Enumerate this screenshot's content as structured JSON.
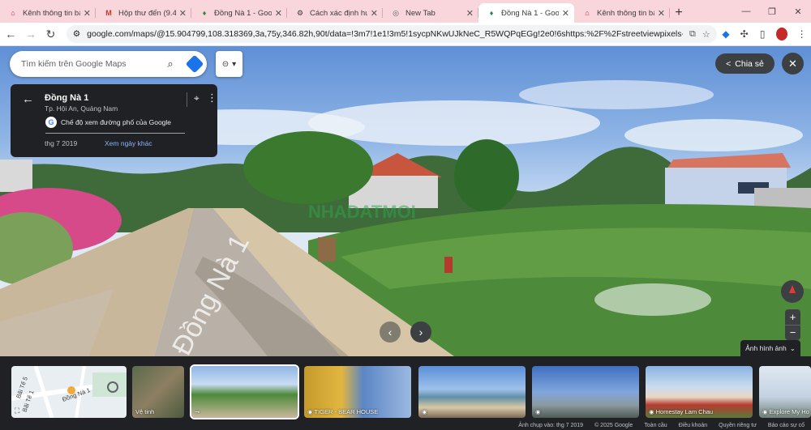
{
  "browser": {
    "tabs": [
      {
        "title": "Kênh thông tin bất đ",
        "icon": "home-icon",
        "icon_color": "#c62828",
        "active": false
      },
      {
        "title": "Hộp thư đến (9.470)",
        "icon": "gmail-icon",
        "icon_color": "#d93025",
        "active": false
      },
      {
        "title": "Đồng Nà 1 - Google",
        "icon": "maps-pin-icon",
        "icon_color": "#1e8e3e",
        "active": false
      },
      {
        "title": "Cách xác định hướng",
        "icon": "gear-icon",
        "icon_color": "#333333",
        "active": false
      },
      {
        "title": "New Tab",
        "icon": "chrome-icon",
        "icon_color": "#5f6368",
        "active": false
      },
      {
        "title": "Đồng Nà 1 - Google",
        "icon": "maps-pin-icon",
        "icon_color": "#1e8e3e",
        "active": true
      },
      {
        "title": "Kênh thông tin bất đ",
        "icon": "home-icon",
        "icon_color": "#c62828",
        "active": false
      }
    ],
    "url": "google.com/maps/@15.904799,108.318369,3a,75y,346.82h,90t/data=!3m7!1e1!3m5!1sycpNKwUJkNeC_R5WQPqEGg!2e0!6shttps:%2F%2Fstreetviewpixels-pa.googleapis.com%2Fv1..."
  },
  "search": {
    "placeholder": "Tìm kiếm trên Google Maps"
  },
  "info_card": {
    "title": "Đồng Nà 1",
    "subtitle": "Tp. Hội An, Quảng Nam",
    "mode_label": "Chế độ xem đường phố của Google",
    "capture_date": "thg 7 2019",
    "more_dates_label": "Xem ngày khác"
  },
  "share_label": "Chia sẻ",
  "photos_toggle_label": "Ảnh hình ảnh",
  "filmstrip": {
    "thumbs": [
      {
        "label": "",
        "kind": "map"
      },
      {
        "label": "Vệ tinh",
        "kind": "satellite"
      },
      {
        "label": "",
        "kind": "street"
      },
      {
        "label": "TIGER - BEAR HOUSE",
        "kind": "photo"
      },
      {
        "label": "",
        "kind": "beach"
      },
      {
        "label": "",
        "kind": "city"
      },
      {
        "label": "Homestay  Lam Chau",
        "kind": "house"
      },
      {
        "label": "Explore My Ho",
        "kind": "sky"
      }
    ],
    "map_labels": [
      "Bãi Tế 5",
      "Bãi Tế 1",
      "Đồng Nà 1"
    ]
  },
  "status": {
    "capture": "Ảnh chụp vào: thg 7 2019",
    "copyright": "© 2025 Google",
    "links": [
      "Toàn cầu",
      "Điều khoản",
      "Quyền riêng tư",
      "Báo cáo sự cố"
    ]
  },
  "colors": {
    "tabstrip": "#f9d6dc",
    "panel_dark": "#202124",
    "link_blue": "#8ab4f8",
    "accent_blue": "#1a73e8"
  }
}
